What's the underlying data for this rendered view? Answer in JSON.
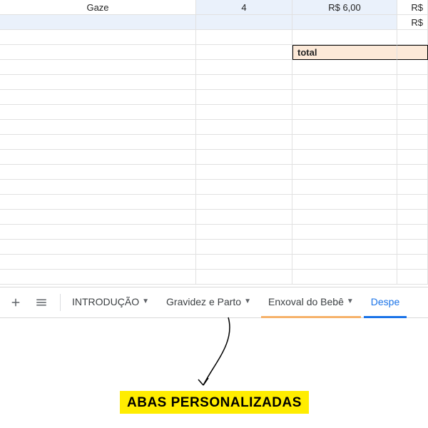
{
  "sheet": {
    "rows": [
      {
        "a": "Gaze",
        "b": "4",
        "c": "R$ 6,00",
        "d": "R$"
      },
      {
        "a": "",
        "b": "",
        "c": "",
        "d": "R$",
        "style": "blue"
      },
      {
        "a": "",
        "b": "",
        "c": "",
        "d": ""
      },
      {
        "a": "",
        "b": "",
        "c": "total",
        "d": "",
        "style": "total"
      }
    ],
    "emptyRowsAfter": 15
  },
  "tabs": {
    "items": [
      {
        "label": "INTRODUÇÃO",
        "hasCaret": true,
        "style": "plain"
      },
      {
        "label": "Gravidez e Parto",
        "hasCaret": true,
        "style": "plain"
      },
      {
        "label": "Enxoval do Bebê",
        "hasCaret": true,
        "style": "gold"
      },
      {
        "label": "Despe",
        "hasCaret": false,
        "style": "active"
      }
    ]
  },
  "annotation": {
    "text": "ABAS PERSONALIZADAS"
  }
}
